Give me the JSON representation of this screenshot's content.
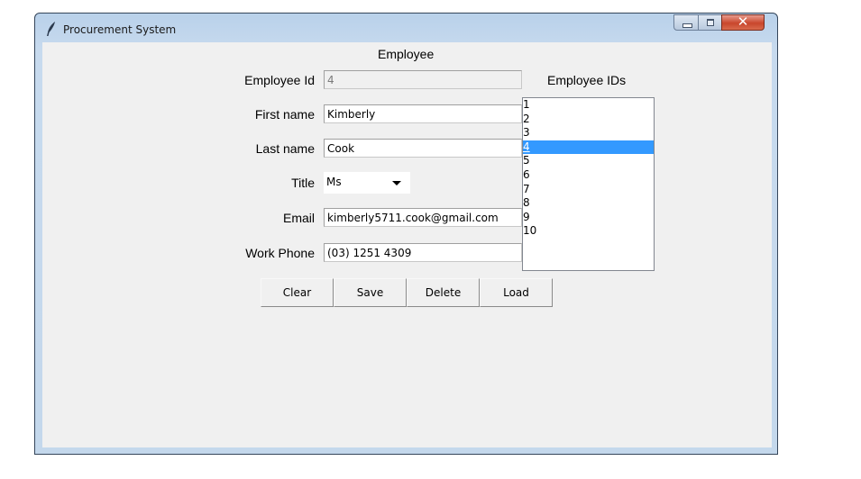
{
  "window": {
    "title": "Procurement System",
    "app_icon": "feather-icon",
    "controls": {
      "minimize": "minimize-icon",
      "maximize": "maximize-icon",
      "close": "close-icon",
      "close_glyph": "✕"
    }
  },
  "form": {
    "heading": "Employee",
    "fields": {
      "employee_id": {
        "label": "Employee Id",
        "value": "4"
      },
      "first_name": {
        "label": "First name",
        "value": "Kimberly"
      },
      "last_name": {
        "label": "Last name",
        "value": "Cook"
      },
      "title": {
        "label": "Title",
        "value": "Ms"
      },
      "email": {
        "label": "Email",
        "value": "kimberly5711.cook@gmail.com"
      },
      "work_phone": {
        "label": "Work Phone",
        "value": "(03) 1251 4309"
      }
    },
    "buttons": {
      "clear": "Clear",
      "save": "Save",
      "delete": "Delete",
      "load": "Load"
    }
  },
  "id_list": {
    "label": "Employee IDs",
    "items": [
      "1",
      "2",
      "3",
      "4",
      "5",
      "6",
      "7",
      "8",
      "9",
      "10"
    ],
    "selected": "4",
    "highlight_color": "#3399ff"
  }
}
